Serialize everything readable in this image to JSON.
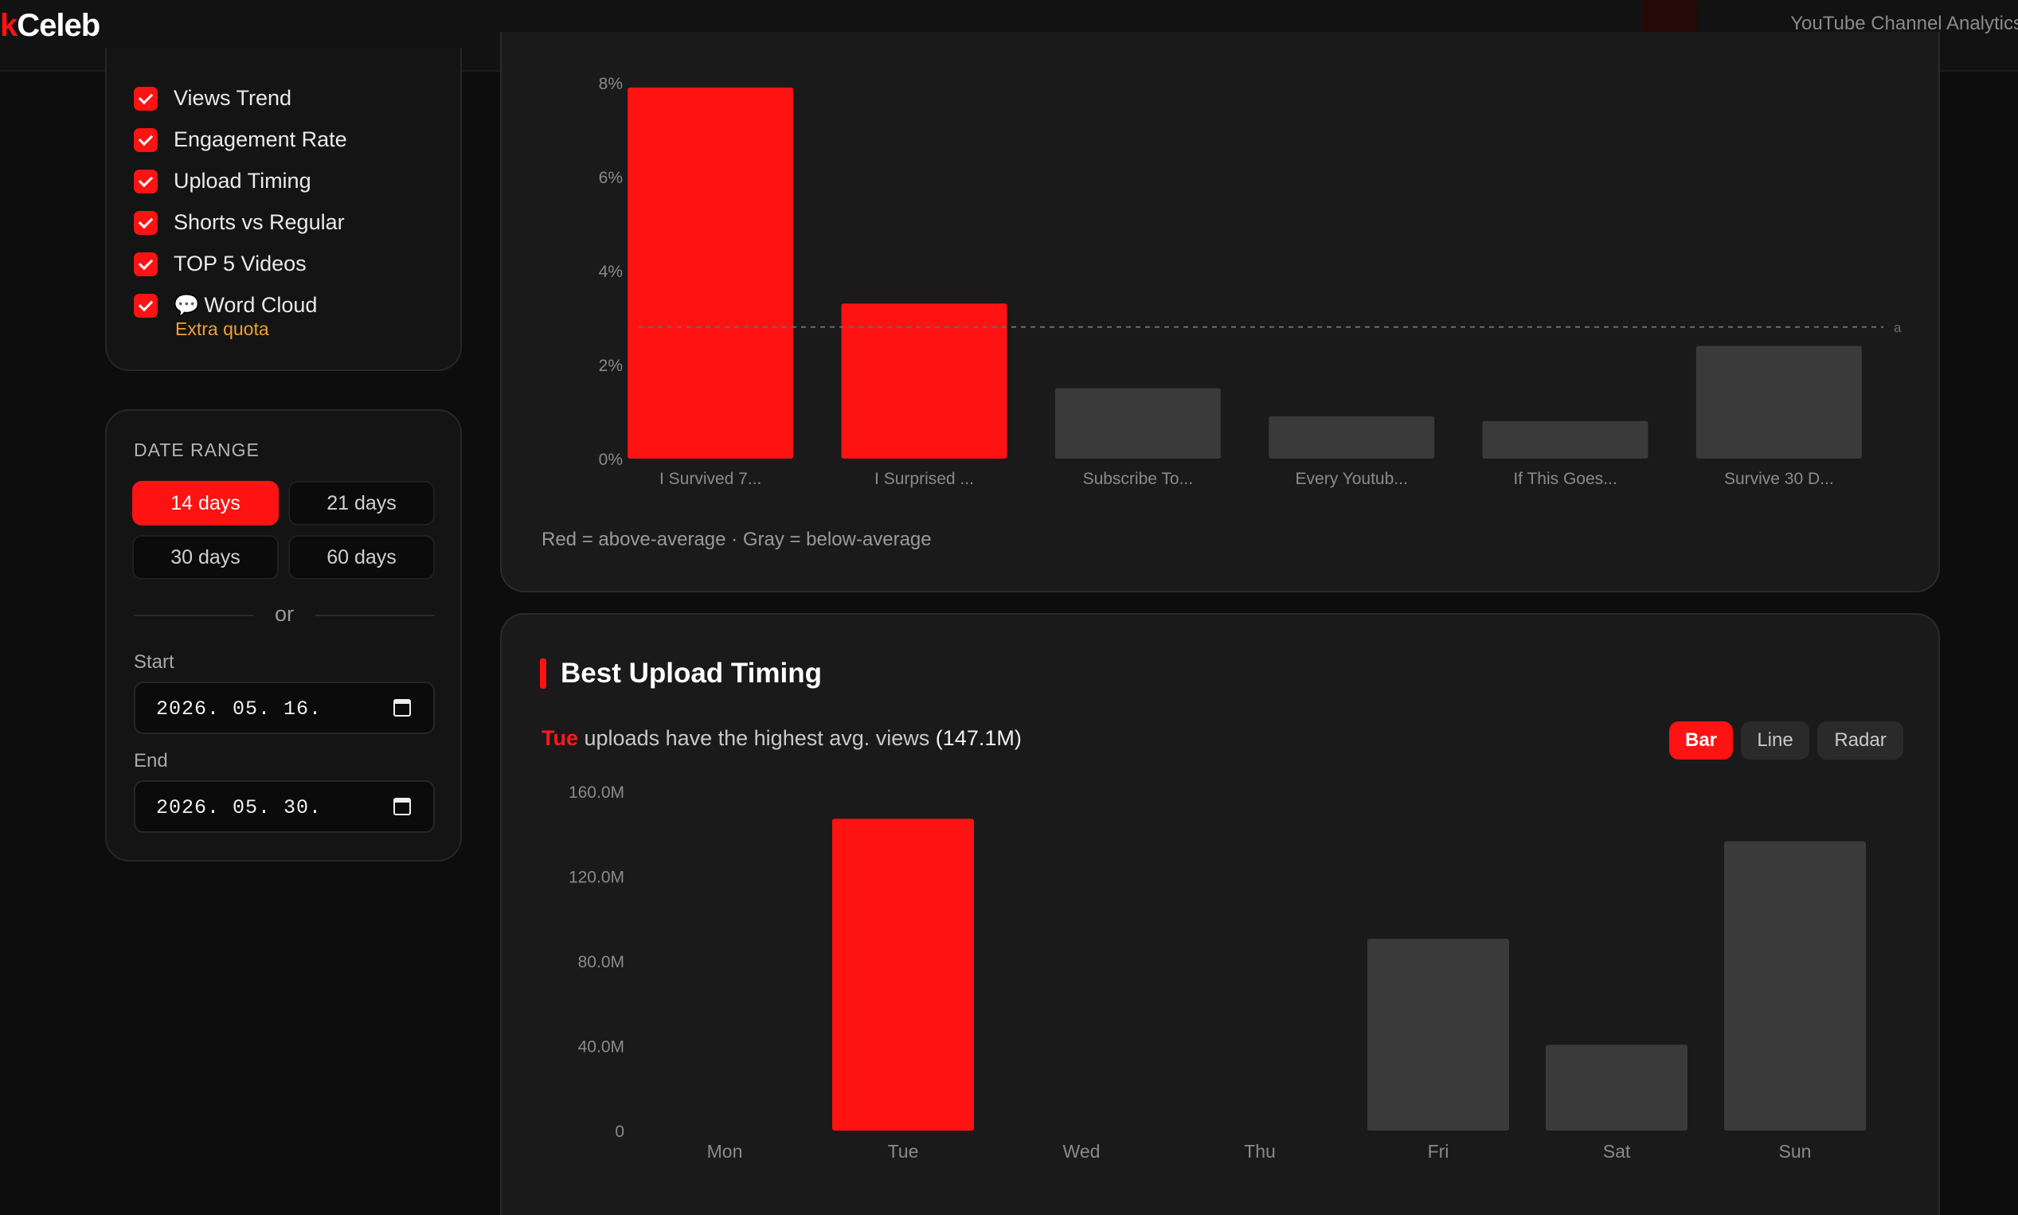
{
  "header": {
    "brand_accent": "k",
    "brand_rest": "Celeb",
    "subtitle": "YouTube Channel Analytics"
  },
  "sidebar": {
    "metrics": [
      {
        "label": "Views Trend",
        "checked": true
      },
      {
        "label": "Engagement Rate",
        "checked": true
      },
      {
        "label": "Upload Timing",
        "checked": true
      },
      {
        "label": "Shorts vs Regular",
        "checked": true
      },
      {
        "label": "TOP 5 Videos",
        "checked": true
      },
      {
        "label": "Word Cloud",
        "checked": true,
        "icon": "speech-bubble-icon"
      }
    ],
    "extra_quota": "Extra quota",
    "date_range": {
      "title": "DATE RANGE",
      "options": [
        "14 days",
        "21 days",
        "30 days",
        "60 days"
      ],
      "selected": "14 days",
      "or_label": "or",
      "start_label": "Start",
      "start_value": "2026. 05. 16.",
      "end_label": "End",
      "end_value": "2026. 05. 30."
    }
  },
  "engagement_card": {
    "legend_note": "Red = above-average · Gray = below-average",
    "avg_line_label": "a"
  },
  "timing_card": {
    "title": "Best Upload Timing",
    "insight_day": "Tue",
    "insight_text": " uploads have the highest avg. views ",
    "insight_value": "(147.1M)",
    "toggles": [
      "Bar",
      "Line",
      "Radar"
    ],
    "active_toggle": "Bar"
  },
  "colors": {
    "accent": "#ff1212",
    "below_avg": "#3a3a3a",
    "quota": "#f0a030"
  },
  "chart_data": [
    {
      "type": "bar",
      "categories": [
        "I Survived 7...",
        "I Surprised ...",
        "Subscribe To...",
        "Every Youtub...",
        "If This Goes...",
        "Survive 30 D..."
      ],
      "values": [
        7.9,
        3.3,
        1.5,
        0.9,
        0.8,
        2.4
      ],
      "average": 2.8,
      "yticks": [
        "0%",
        "2%",
        "4%",
        "6%",
        "8%"
      ],
      "ylim": [
        0,
        8
      ],
      "above_average": [
        true,
        true,
        false,
        false,
        false,
        false
      ],
      "grid": false
    },
    {
      "type": "bar",
      "categories": [
        "Mon",
        "Tue",
        "Wed",
        "Thu",
        "Fri",
        "Sat",
        "Sun"
      ],
      "values": [
        0,
        147.1,
        0,
        0,
        90.5,
        40.5,
        136.5
      ],
      "unit": "M",
      "yticks": [
        "0",
        "40.0M",
        "80.0M",
        "120.0M",
        "160.0M"
      ],
      "ylim": [
        0,
        160
      ],
      "highlight": "Tue",
      "grid": false
    }
  ]
}
